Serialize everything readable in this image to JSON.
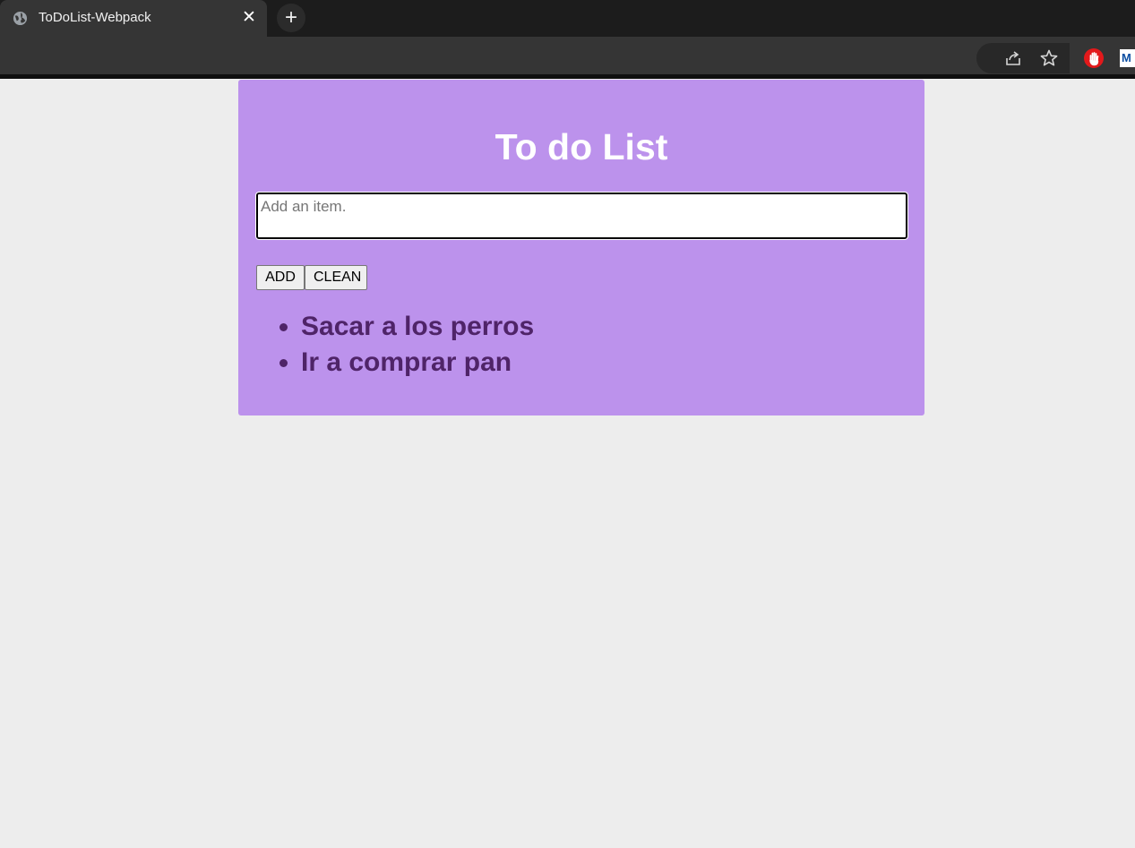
{
  "browser": {
    "tab_title": "ToDoList-Webpack",
    "tab_close_glyph": "✕",
    "new_tab_glyph": "+",
    "toolbar_icons": [
      "share-icon",
      "star-icon",
      "stop-extension-icon",
      "m-extension-icon"
    ]
  },
  "app": {
    "title": "To do List",
    "input": {
      "placeholder": "Add an item.",
      "value": ""
    },
    "buttons": {
      "add_label": "ADD",
      "clean_label": "CLEAN"
    },
    "items": [
      "Sacar a los perros",
      "Ir a comprar pan"
    ]
  },
  "colors": {
    "card_background": "#bc92ec",
    "page_background": "#ededed",
    "item_text": "#4f2468",
    "title_text": "#ffffff"
  }
}
